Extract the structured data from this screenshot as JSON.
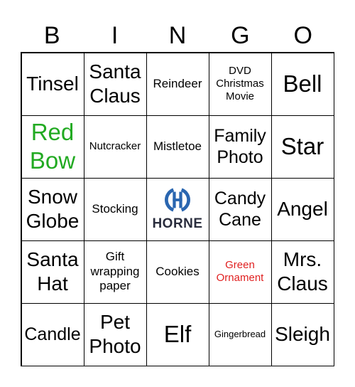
{
  "header": [
    "B",
    "I",
    "N",
    "G",
    "O"
  ],
  "cells": [
    {
      "text": "Tinsel",
      "size": "l"
    },
    {
      "text": "Santa Claus",
      "size": "l"
    },
    {
      "text": "Reindeer",
      "size": "s"
    },
    {
      "text": "DVD Christmas Movie",
      "size": "xs"
    },
    {
      "text": "Bell",
      "size": "xl"
    },
    {
      "text": "Red Bow",
      "size": "xl",
      "color": "green"
    },
    {
      "text": "Nutcracker",
      "size": "xs"
    },
    {
      "text": "Mistletoe",
      "size": "s"
    },
    {
      "text": "Family Photo",
      "size": "m"
    },
    {
      "text": "Star",
      "size": "xl"
    },
    {
      "text": "Snow Globe",
      "size": "l"
    },
    {
      "text": "Stocking",
      "size": "s"
    },
    {
      "text": "HORNE",
      "logo": true,
      "icon": "horne-logo-icon",
      "logo_color": "#2a66b0"
    },
    {
      "text": "Candy Cane",
      "size": "m"
    },
    {
      "text": "Angel",
      "size": "l"
    },
    {
      "text": "Santa Hat",
      "size": "l"
    },
    {
      "text": "Gift wrapping paper",
      "size": "s"
    },
    {
      "text": "Cookies",
      "size": "s"
    },
    {
      "text": "Green Ornament",
      "size": "xs",
      "color": "red"
    },
    {
      "text": "Mrs. Claus",
      "size": "l"
    },
    {
      "text": "Candle",
      "size": "m"
    },
    {
      "text": "Pet Photo",
      "size": "l"
    },
    {
      "text": "Elf",
      "size": "xl"
    },
    {
      "text": "Gingerbread",
      "size": "xxs"
    },
    {
      "text": "Sleigh",
      "size": "l"
    }
  ]
}
